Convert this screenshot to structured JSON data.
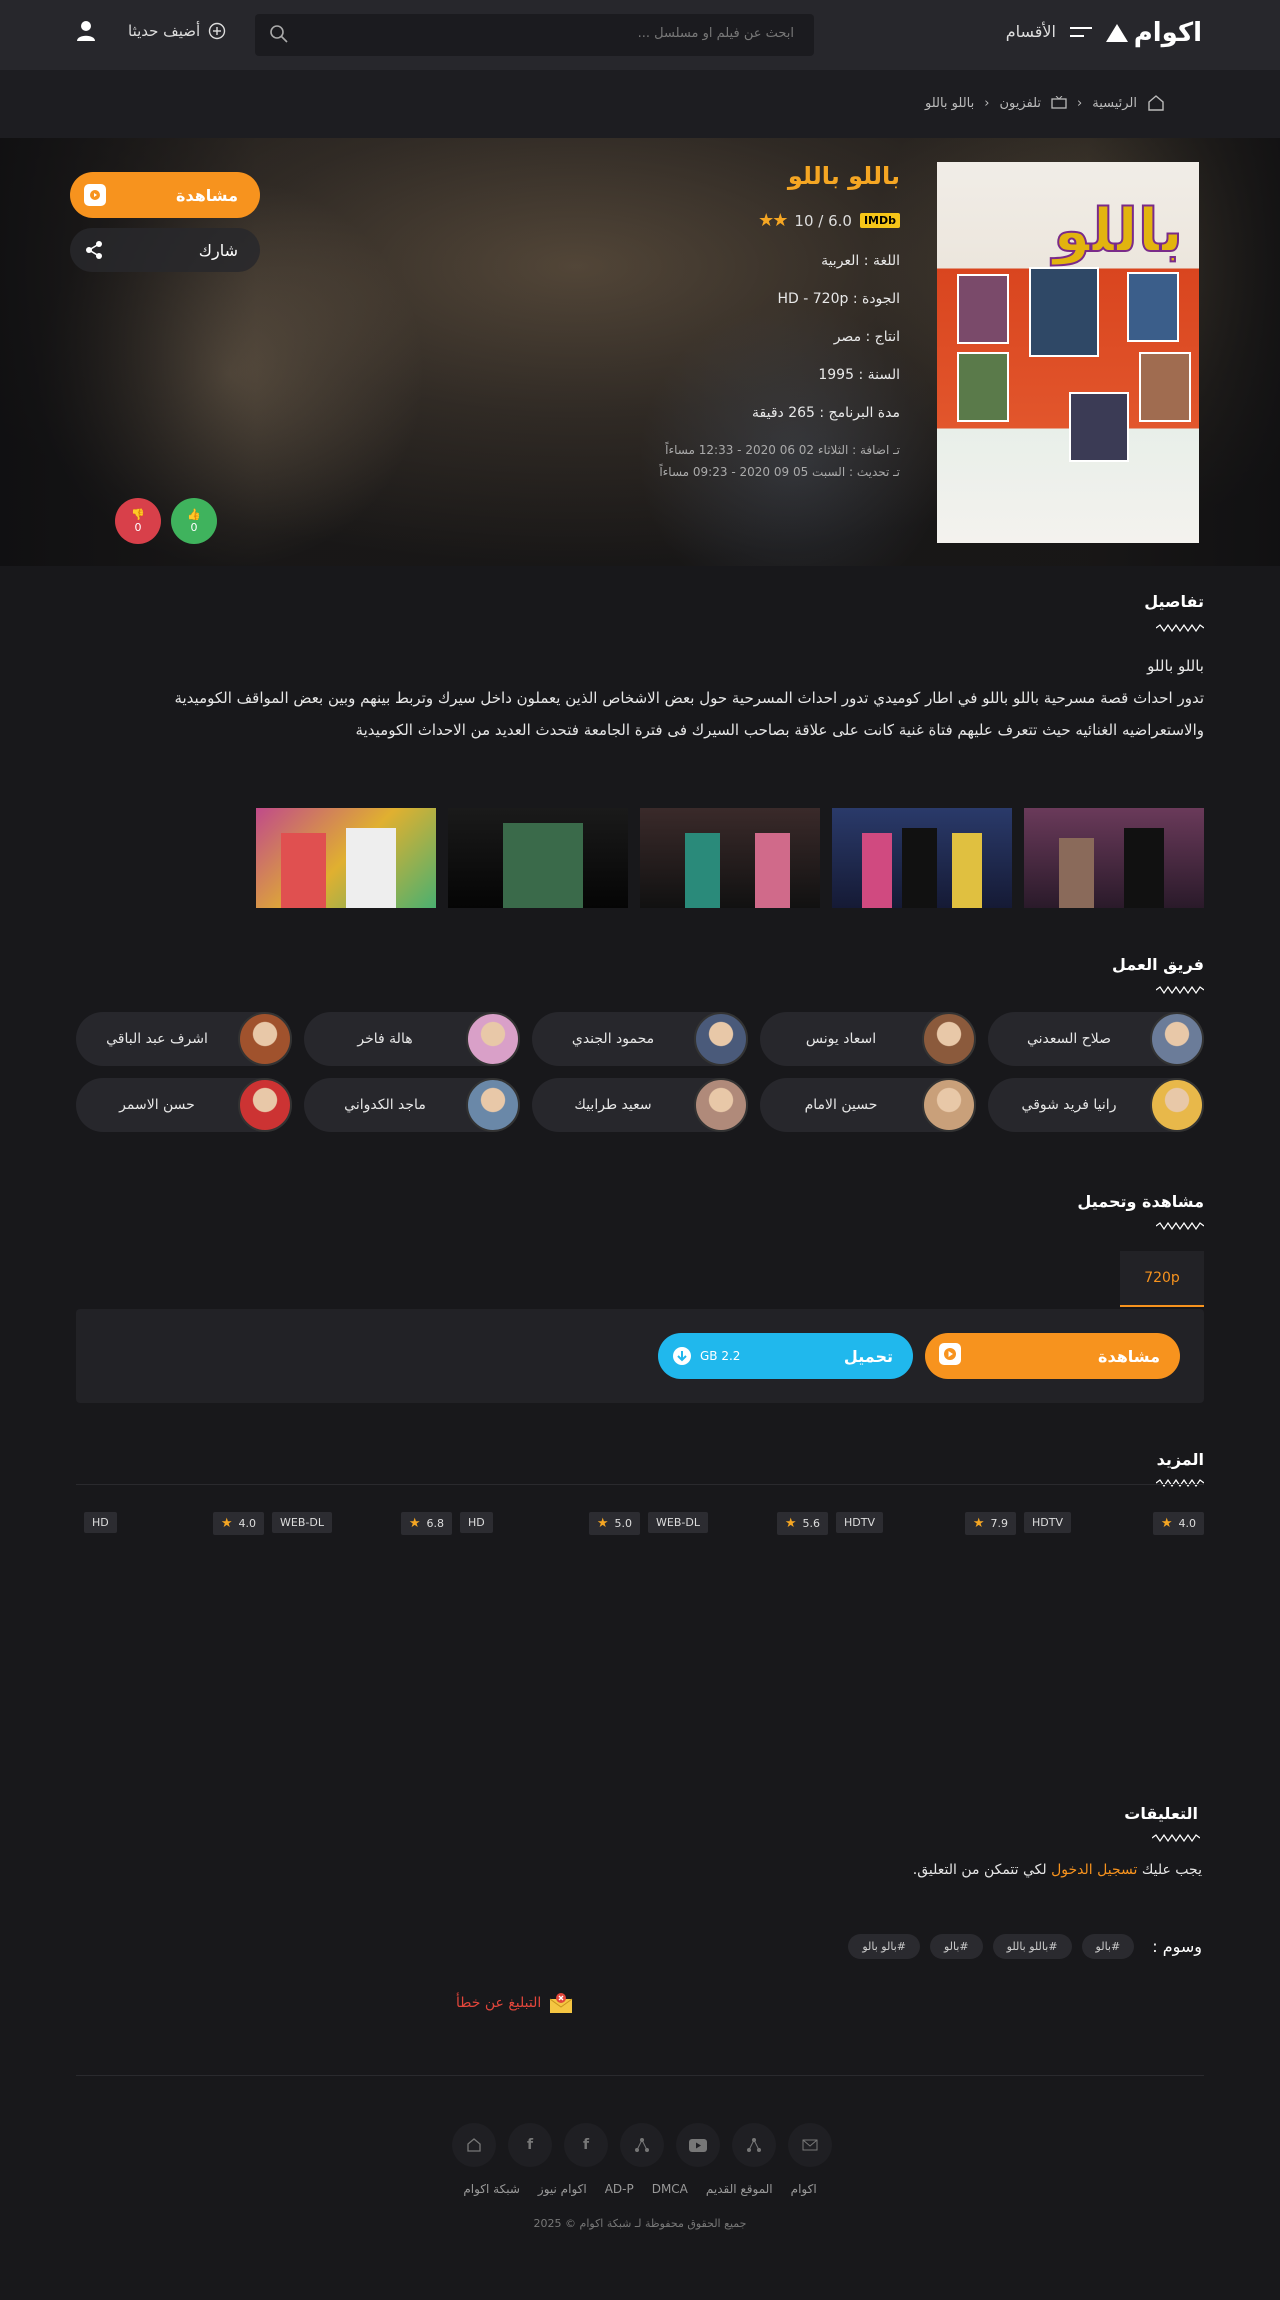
{
  "header": {
    "logo_text": "اكوام",
    "menu_label": "الأقسام",
    "search_placeholder": "ابحث عن فيلم او مسلسل ...",
    "added_recently": "أضيف حديثا"
  },
  "breadcrumb": {
    "home": "الرئيسية",
    "category": "تلفزيون",
    "current": "باللو باللو"
  },
  "movie": {
    "title": "باللو باللو",
    "poster_title": "باللو",
    "imdb_badge": "IMDb",
    "rating": "6.0 / 10",
    "rating_value": 6.0,
    "language": "اللغة : العربية",
    "quality": "الجودة : HD - 720p",
    "production": "انتاج : مصر",
    "year": "السنة : 1995",
    "duration": "مدة البرنامج : 265 دقيقة",
    "added": "تـ اضافة : الثلاثاء 02 06 2020 - 12:33 مساءاً",
    "updated": "تـ تحديث : السبت 05 09 2020 - 09:23 مساءاً",
    "watch_label": "مشاهدة",
    "share_label": "شارك",
    "likes": "0",
    "dislikes": "0"
  },
  "details": {
    "heading": "تفاصيل",
    "line1": "باللو باللو",
    "line2": "تدور احداث قصة مسرحية باللو باللو في اطار كوميدي تدور احداث المسرحية حول بعض الاشخاص الذين يعملون داخل سيرك وتربط بينهم وبين بعض المواقف الكوميدية",
    "line3": "والاستعراضيه الغنائيه حيث تتعرف عليهم فتاة غنية كانت على علاقة بصاحب السيرك فى فترة الجامعة فتحدث العديد من الاحداث الكوميدية"
  },
  "cast": {
    "heading": "فريق العمل",
    "members": [
      {
        "name": "صلاح السعدني",
        "color": "#6b7c99"
      },
      {
        "name": "اسعاد يونس",
        "color": "#8b5a3c"
      },
      {
        "name": "محمود الجندي",
        "color": "#4a5a7a"
      },
      {
        "name": "هالة فاخر",
        "color": "#d9a0c8"
      },
      {
        "name": "اشرف عبد الباقي",
        "color": "#a0522d"
      },
      {
        "name": "رانيا فريد شوقي",
        "color": "#e8b84a"
      },
      {
        "name": "حسين الامام",
        "color": "#c9a07a"
      },
      {
        "name": "سعيد طرابيك",
        "color": "#b08a7a"
      },
      {
        "name": "ماجد الكدواني",
        "color": "#6a88a8"
      },
      {
        "name": "حسن الاسمر",
        "color": "#cc3333"
      }
    ]
  },
  "downloads": {
    "heading": "مشاهدة وتحميل",
    "tab": "720p",
    "watch_label": "مشاهدة",
    "download_label": "تحميل",
    "size": "2.2 GB"
  },
  "more": {
    "heading": "المزيد",
    "items": [
      {
        "rating": "4.0",
        "quality": "HDTV"
      },
      {
        "rating": "7.9",
        "quality": "HDTV"
      },
      {
        "rating": "5.6",
        "quality": "WEB-DL"
      },
      {
        "rating": "5.0",
        "quality": "HD"
      },
      {
        "rating": "6.8",
        "quality": "WEB-DL"
      },
      {
        "rating": "4.0",
        "quality": "HD"
      }
    ]
  },
  "comments": {
    "heading": "التعليقات",
    "prefix": "يجب عليك",
    "login_link": "تسجيل الدخول",
    "suffix": "لكي تتمكن من التعليق."
  },
  "tags": {
    "label": "وسوم :",
    "items": [
      "#بالو",
      "#باللو باللو",
      "#بالو",
      "#بالو بالو"
    ]
  },
  "report": "التبليغ عن خطأ",
  "footer": {
    "links": [
      "اكوام",
      "الموقع القديم",
      "DMCA",
      "AD-P",
      "اكوام نيوز",
      "شبكة اكوام"
    ],
    "copyright": "جميع الحقوق محفوظة لـ شبكة اكوام © 2025"
  },
  "colors": {
    "accent": "#f7931e",
    "download": "#20b8ed",
    "like": "#3fb35d",
    "dislike": "#d8404a",
    "title": "#f5a623"
  }
}
